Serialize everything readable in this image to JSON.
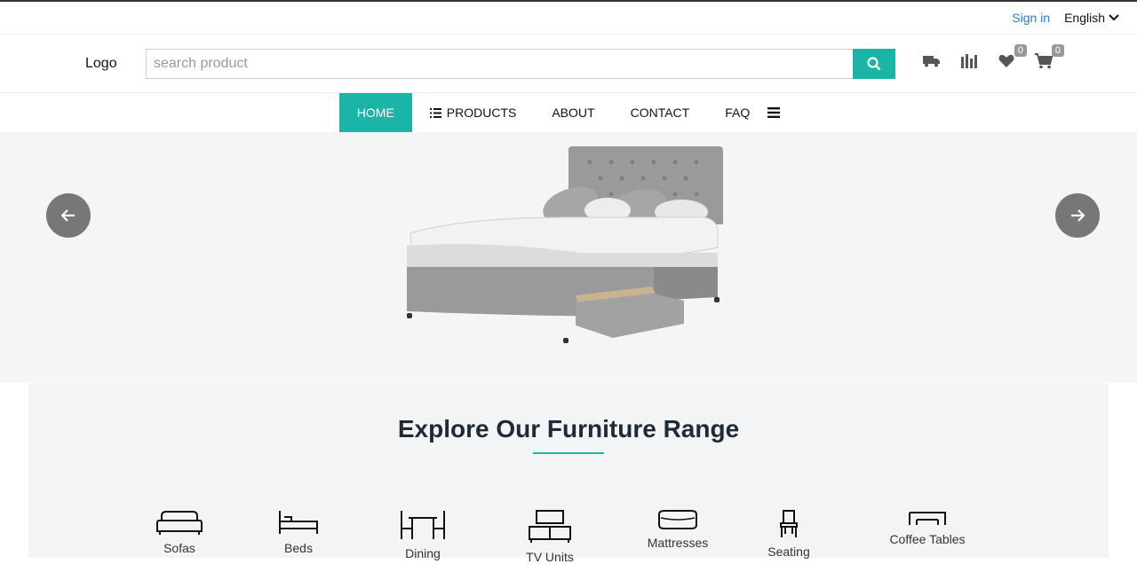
{
  "topbar": {
    "signin": "Sign in",
    "language": "English"
  },
  "header": {
    "logo": "Logo",
    "search_placeholder": "search product",
    "wishlist_count": "0",
    "cart_count": "0"
  },
  "nav": {
    "home": "HOME",
    "products": "PRODUCTS",
    "about": "ABOUT",
    "contact": "CONTACT",
    "faq": "FAQ"
  },
  "explore": {
    "title": "Explore Our Furniture Range",
    "categories": [
      "Sofas",
      "Beds",
      "Dining",
      "TV Units",
      "Mattresses",
      "Seating",
      "Coffee Tables"
    ]
  },
  "colors": {
    "accent": "#1ab5a6",
    "link": "#2b7bd1"
  }
}
